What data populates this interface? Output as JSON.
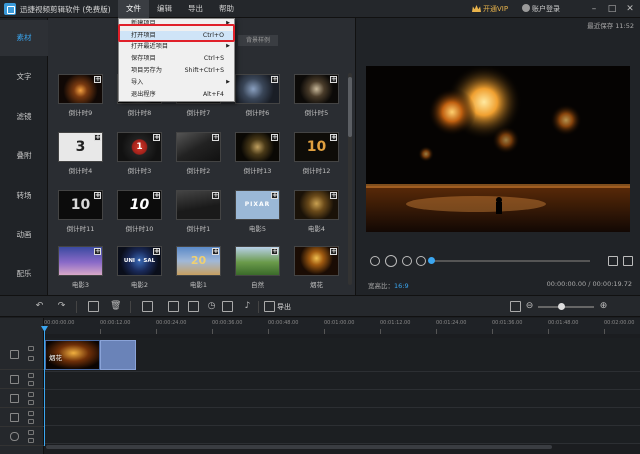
{
  "app": {
    "title": "迅捷视频剪辑软件 (免费版)"
  },
  "menu": [
    {
      "label": "文件"
    },
    {
      "label": "编辑"
    },
    {
      "label": "导出"
    },
    {
      "label": "帮助"
    }
  ],
  "header": {
    "vip_label": "开通VIP",
    "account_label": "账户登录",
    "autosave": "最近保存 11:52",
    "minimize": "–",
    "maximize": "□",
    "close": "✕"
  },
  "file_menu": {
    "items": [
      {
        "label": "新建项目",
        "shortcut": "",
        "submenu": true
      },
      {
        "label": "打开项目",
        "shortcut": "Ctrl+O",
        "submenu": false
      },
      {
        "label": "打开最近项目",
        "shortcut": "",
        "submenu": true
      },
      {
        "label": "保存项目",
        "shortcut": "Ctrl+S",
        "submenu": false
      },
      {
        "label": "项目另存为",
        "shortcut": "Shift+Ctrl+S",
        "submenu": false
      },
      {
        "label": "导入",
        "shortcut": "",
        "submenu": true
      },
      {
        "label": "退出程序",
        "shortcut": "Alt+F4",
        "submenu": false
      }
    ],
    "highlighted_index": 1
  },
  "leftnav": {
    "items": [
      {
        "label": "素材"
      },
      {
        "label": "文字"
      },
      {
        "label": "滤镜"
      },
      {
        "label": "叠附"
      },
      {
        "label": "转场"
      },
      {
        "label": "动画"
      },
      {
        "label": "配乐"
      }
    ],
    "active_index": 0
  },
  "library": {
    "bg_tab": "背景样例",
    "thumbs": [
      {
        "label": "倒计时9",
        "glyph": ""
      },
      {
        "label": "倒计时8",
        "glyph": ""
      },
      {
        "label": "倒计时7",
        "glyph": ""
      },
      {
        "label": "倒计时6",
        "glyph": ""
      },
      {
        "label": "倒计时5",
        "glyph": ""
      },
      {
        "label": "倒计时4",
        "glyph": "3"
      },
      {
        "label": "倒计时3",
        "glyph": "1"
      },
      {
        "label": "倒计时2",
        "glyph": ""
      },
      {
        "label": "倒计时13",
        "glyph": ""
      },
      {
        "label": "倒计时12",
        "glyph": "10"
      },
      {
        "label": "倒计时11",
        "glyph": "10"
      },
      {
        "label": "倒计时10",
        "glyph": "10"
      },
      {
        "label": "倒计时1",
        "glyph": ""
      },
      {
        "label": "电影5",
        "glyph": "PIXAR"
      },
      {
        "label": "电影4",
        "glyph": ""
      },
      {
        "label": "电影3",
        "glyph": ""
      },
      {
        "label": "电影2",
        "glyph": "UNI ✦ SAL"
      },
      {
        "label": "电影1",
        "glyph": "20"
      },
      {
        "label": "自然",
        "glyph": ""
      },
      {
        "label": "烟花",
        "glyph": ""
      }
    ]
  },
  "preview": {
    "aspect_label": "宽高比：",
    "aspect_value": "16:9",
    "time_current": "00:00:00.00",
    "time_separator": "/",
    "time_total": "00:00:19.72",
    "progress": 0.0
  },
  "timeline": {
    "export_label": "导出",
    "ruler": [
      "00:00:00.00",
      "00:00:12.00",
      "00:00:24.00",
      "00:00:36.00",
      "00:00:48.00",
      "00:01:00.00",
      "00:01:12.00",
      "00:01:24.00",
      "00:01:36.00",
      "00:01:48.00",
      "00:02:00.00"
    ],
    "clip_label": "烟花"
  },
  "colors": {
    "accent": "#3ba6f0",
    "menu_highlight_border": "#e0202a",
    "vip": "#e8b34b"
  }
}
